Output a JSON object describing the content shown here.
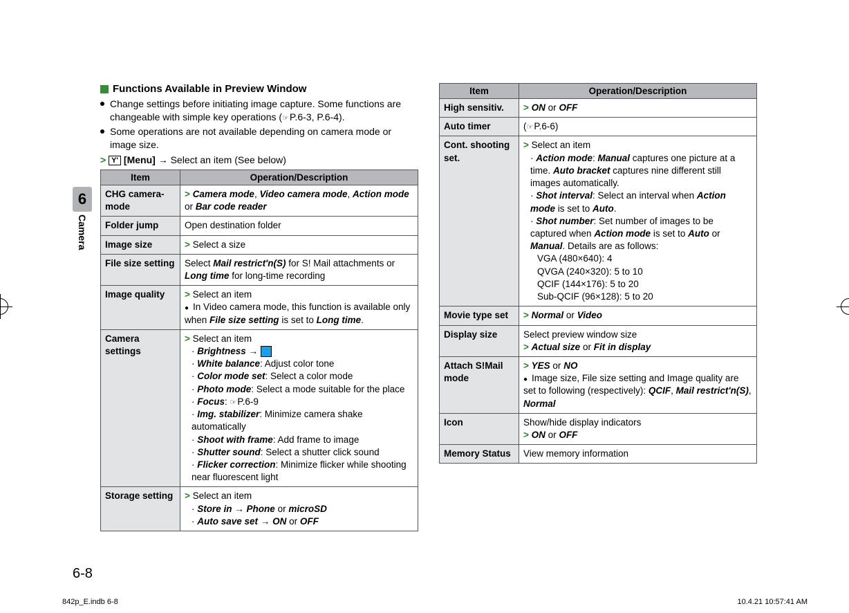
{
  "chapter": {
    "number": "6",
    "name": "Camera"
  },
  "page_number": "6-8",
  "footer": {
    "left": "842p_E.indb   6-8",
    "right": "10.4.21   10:57:41 AM"
  },
  "section_title": "Functions Available in Preview Window",
  "intro_bullets": [
    "Change settings before initiating image capture. Some functions are changeable with simple key operations (P.6-3, P.6-4).",
    "Some operations are not available depending on camera mode or image size."
  ],
  "step_prefix": "[Menu]",
  "step_text": "Select an item (See below)",
  "table_header": {
    "item": "Item",
    "op": "Operation/Description"
  },
  "left_rows": {
    "chg": {
      "item": "CHG camera-mode",
      "options": [
        "Camera mode",
        "Video camera mode",
        "Action mode",
        "Bar code reader"
      ],
      "sep_or": "or",
      "sep_comma": ", "
    },
    "folder": {
      "item": "Folder jump",
      "desc": "Open destination folder"
    },
    "imgsize": {
      "item": "Image size",
      "desc": "Select a size"
    },
    "filesize": {
      "item": "File size setting",
      "pre": "Select ",
      "opt1": "Mail restrict'n(S)",
      "mid": " for S! Mail attachments or ",
      "opt2": "Long time",
      "post": " for long-time recording"
    },
    "quality": {
      "item": "Image quality",
      "select": "Select an item",
      "note_pre": "In Video camera mode, this function is available only when ",
      "note_b1": "File size setting",
      "note_mid": " is set to ",
      "note_b2": "Long time",
      "note_post": "."
    },
    "camset": {
      "item": "Camera settings",
      "select": "Select an item",
      "lines": {
        "brightness": "Brightness",
        "wb": "White balance",
        "wb_desc": ": Adjust color tone",
        "cm": "Color mode set",
        "cm_desc": ": Select a color mode",
        "pm": "Photo mode",
        "pm_desc": ": Select a mode suitable for the place",
        "focus": "Focus",
        "focus_ref": "P.6-9",
        "stab": "Img. stabilizer",
        "stab_desc": ": Minimize camera shake automatically",
        "swf": "Shoot with frame",
        "swf_desc": ": Add frame to image",
        "ss": "Shutter sound",
        "ss_desc": ": Select a shutter click sound",
        "fc": "Flicker correction",
        "fc_desc": ": Minimize flicker while shooting near fluorescent light"
      }
    },
    "storage": {
      "item": "Storage setting",
      "select": "Select an item",
      "store_in": "Store in",
      "phone": "Phone",
      "or": "or",
      "microsd": "microSD",
      "autosave": "Auto save set",
      "on": "ON",
      "off": "OFF"
    }
  },
  "right_rows": {
    "hs": {
      "item": "High sensitiv.",
      "on": "ON",
      "or": "or",
      "off": "OFF"
    },
    "timer": {
      "item": "Auto timer",
      "ref": "P.6-6"
    },
    "cont": {
      "item": "Cont. shooting set.",
      "select": "Select an item",
      "am": "Action mode",
      "am_desc1": ": ",
      "manual": "Manual",
      "am_desc2": " captures one picture at a time. ",
      "ab": "Auto bracket",
      "am_desc3": " captures nine different still images automatically.",
      "si": "Shot interval",
      "si_desc1": ": Select an interval when ",
      "si_am": "Action mode",
      "si_desc2": " is set to ",
      "si_auto": "Auto",
      "si_desc3": ".",
      "sn": "Shot number",
      "sn_desc1": ": Set number of images to be captured when ",
      "sn_am": "Action mode",
      "sn_desc2": " is set to ",
      "sn_auto": "Auto",
      "sn_or": " or ",
      "sn_manual": "Manual",
      "sn_desc3": ". Details are as follows:",
      "sizes": [
        "VGA (480×640): 4",
        "QVGA (240×320): 5 to 10",
        "QCIF (144×176): 5 to 20",
        "Sub-QCIF (96×128): 5 to 20"
      ]
    },
    "movietype": {
      "item": "Movie type set",
      "a": "Normal",
      "or": "or",
      "b": "Video"
    },
    "dispsize": {
      "item": "Display size",
      "desc": "Select preview window size",
      "a": "Actual size",
      "or": "or",
      "b": "Fit in display"
    },
    "attach": {
      "item": "Attach S!Mail mode",
      "a": "YES",
      "or": "or",
      "b": "NO",
      "note_pre": "Image size, File size setting and Image quality are set to following (respectively): ",
      "v1": "QCIF",
      "c": ", ",
      "v2": "Mail restrict'n(S)",
      "v3": "Normal"
    },
    "icon": {
      "item": "Icon",
      "desc": "Show/hide display indicators",
      "on": "ON",
      "or": "or",
      "off": "OFF"
    },
    "mem": {
      "item": "Memory Status",
      "desc": "View memory information"
    }
  }
}
